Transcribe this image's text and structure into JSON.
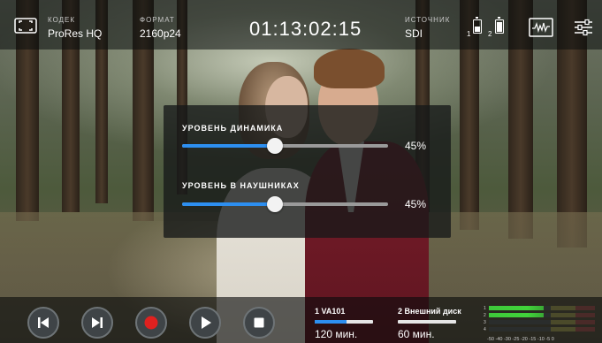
{
  "topbar": {
    "codec_label": "КОДЕК",
    "codec_value": "ProRes HQ",
    "format_label": "ФОРМАТ",
    "format_value": "2160p24",
    "timecode": "01:13:02:15",
    "source_label": "ИСТОЧНИК",
    "source_value": "SDI",
    "slot1_number": "1",
    "slot2_number": "2",
    "icons": {
      "fullscreen": "fullscreen-icon",
      "slot1": "slot-1-battery-icon",
      "slot2": "slot-2-battery-icon",
      "waveform": "waveform-icon",
      "settings": "settings-sliders-icon"
    }
  },
  "panel": {
    "speaker_label": "УРОВЕНЬ ДИНАМИКА",
    "speaker_value": "45%",
    "speaker_level": 0.45,
    "headphones_label": "УРОВЕНЬ В НАУШНИКАХ",
    "headphones_value": "45%",
    "headphones_level": 0.45,
    "accent": "#2d8ff0"
  },
  "transport": [
    {
      "name": "skip-back-button",
      "icon": "skip-back-icon"
    },
    {
      "name": "skip-forward-button",
      "icon": "skip-forward-icon"
    },
    {
      "name": "record-button",
      "icon": "record-icon",
      "color": "#e0211f"
    },
    {
      "name": "play-button",
      "icon": "play-icon"
    },
    {
      "name": "stop-button",
      "icon": "stop-icon"
    }
  ],
  "media": {
    "slot1_title": "1  VA101",
    "slot1_time": "120 мин.",
    "slot1_fill": 0.55,
    "slot2_title": "2 Внешний диск",
    "slot2_time": "60 мин.",
    "slot2_fill": 0.0
  },
  "meters": {
    "channels": [
      "1",
      "2",
      "3",
      "4"
    ],
    "levels": [
      0.52,
      0.52,
      0.0,
      0.0
    ],
    "scale": "-50 -40   -30 -25 -20  -15  -10   -5    0"
  }
}
